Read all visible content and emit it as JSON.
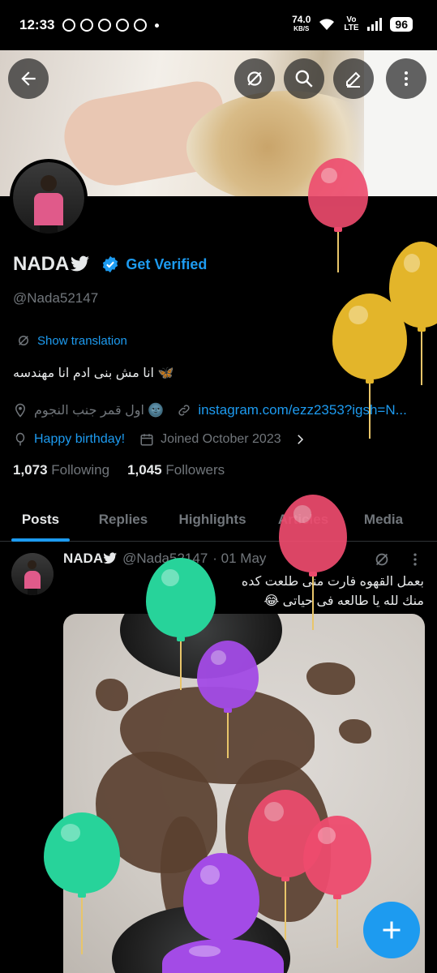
{
  "status_bar": {
    "time": "12:33",
    "net_speed": "74.0",
    "net_unit": "KB/S",
    "network": "Vo LTE",
    "battery": "96"
  },
  "banner": {
    "back_icon": "arrow-left-icon",
    "translate_icon": "translate-icon",
    "search_icon": "search-icon",
    "edit_icon": "pencil-icon",
    "more_icon": "more-vertical-icon"
  },
  "profile": {
    "display_name": "NADA",
    "get_verified": "Get Verified",
    "handle": "@Nada52147",
    "show_translation": "Show translation",
    "bio": "انا مش بنى ادم انا مهندسه 🦋",
    "location": "اول قمر جنب النجوم 🌚",
    "website": "instagram.com/ezz2353?igsh=N...",
    "birthday": "Happy birthday!",
    "joined": "Joined October 2023",
    "following_count": "1,073",
    "following_label": "Following",
    "followers_count": "1,045",
    "followers_label": "Followers"
  },
  "tabs": [
    {
      "label": "Posts",
      "active": true
    },
    {
      "label": "Replies"
    },
    {
      "label": "Highlights"
    },
    {
      "label": "Articles"
    },
    {
      "label": "Media"
    }
  ],
  "post": {
    "author": "NADA",
    "handle": "@Nada52147",
    "date": "· 01 May",
    "line1": "بعمل القهوه فارت منى طلعت كده",
    "line2": "منك لله يا طالعه فى حياتى 😂"
  },
  "colors": {
    "accent": "#1d9bf0",
    "background": "#000000",
    "secondary_text": "#71767b"
  }
}
